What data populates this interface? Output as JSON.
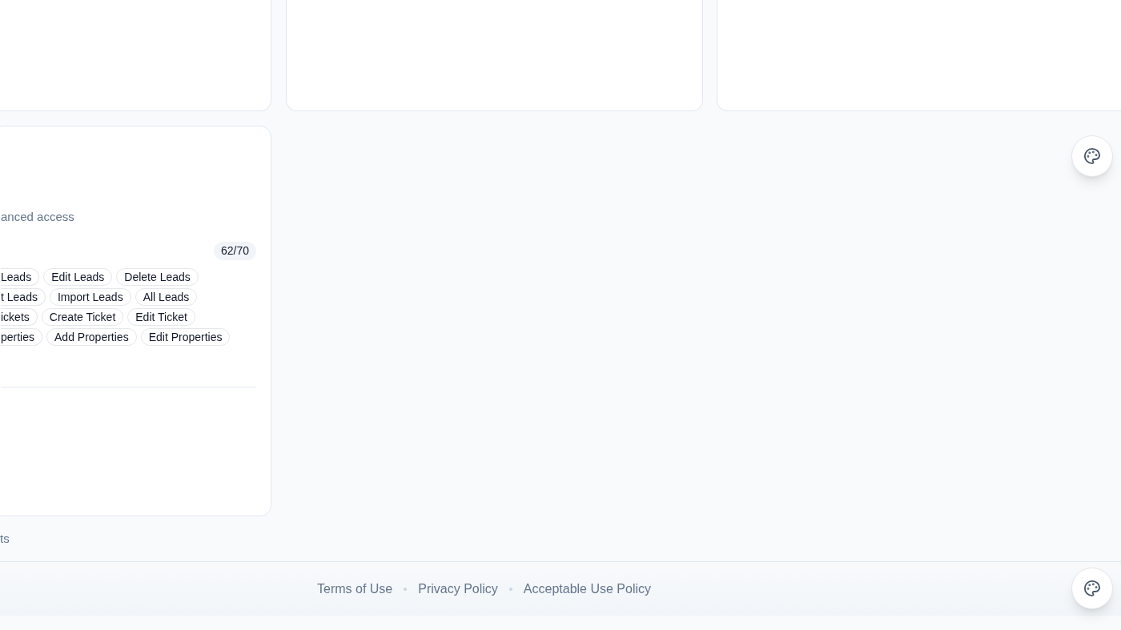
{
  "top_cards": [
    {
      "kind": "card"
    },
    {
      "kind": "card"
    },
    {
      "kind": "card"
    }
  ],
  "role_card": {
    "description": "anced access",
    "count": "62/70",
    "permission_rows": [
      [
        "Leads",
        "Edit Leads",
        "Delete Leads"
      ],
      [
        "t Leads",
        "Import Leads",
        "All Leads"
      ],
      [
        "ickets",
        "Create Ticket",
        "Edit Ticket"
      ],
      [
        "perties",
        "Add Properties",
        "Edit Properties"
      ]
    ]
  },
  "note": "ts",
  "footer": {
    "links": [
      "Terms of Use",
      "Privacy Policy",
      "Acceptable Use Policy"
    ]
  }
}
